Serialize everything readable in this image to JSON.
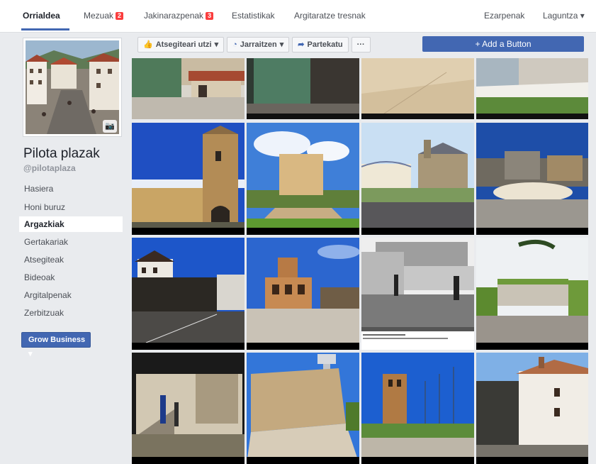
{
  "topnav": {
    "tabs": [
      {
        "label": "Orrialdea",
        "active": true
      },
      {
        "label": "Mezuak",
        "badge": "2"
      },
      {
        "label": "Jakinarazpenak",
        "badge": "3"
      },
      {
        "label": "Estatistikak"
      },
      {
        "label": "Argitaratze tresnak"
      }
    ],
    "settings": "Ezarpenak",
    "help": "Laguntza"
  },
  "sidebar": {
    "page_name": "Pilota plazak",
    "handle": "@pilotaplaza",
    "items": [
      {
        "label": "Hasiera"
      },
      {
        "label": "Honi buruz"
      },
      {
        "label": "Argazkiak",
        "active": true
      },
      {
        "label": "Gertakariak"
      },
      {
        "label": "Atsegiteak"
      },
      {
        "label": "Bideoak"
      },
      {
        "label": "Argitalpenak"
      },
      {
        "label": "Zerbitzuak"
      }
    ],
    "grow_button": "Grow Business"
  },
  "actions": {
    "like": "Atsegiteari utzi",
    "follow": "Jarraitzen",
    "share": "Partekatu",
    "more": "···",
    "add_button": "+ Add a Button"
  },
  "photos": {
    "caption_text": "c Pedro Etxeria"
  },
  "colors": {
    "accent": "#4267b2",
    "badge": "#fa3e3e",
    "background": "#e9ebee"
  }
}
